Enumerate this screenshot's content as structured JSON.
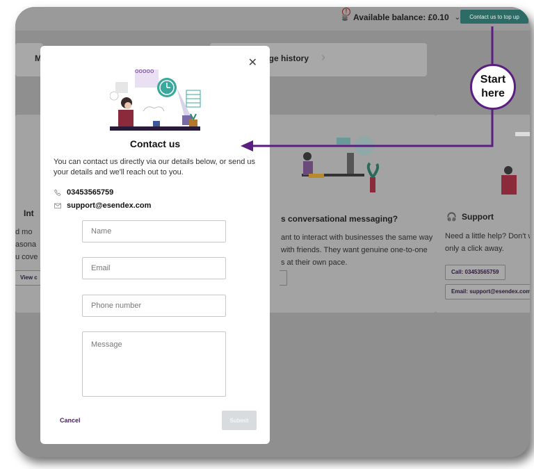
{
  "topbar": {
    "balance_label": "Available balance: £0.10",
    "topup_label": "Contact us to top up"
  },
  "nav": {
    "left_letter": "M",
    "right_label": "age history"
  },
  "bg_cards": {
    "left": {
      "title": "Int",
      "lines": [
        "d mo",
        "asona",
        "u cove"
      ],
      "button": "View c"
    },
    "middle": {
      "title": "s conversational messaging?",
      "lines": [
        "ant to interact with businesses the same way",
        "with friends. They want genuine one-to-one",
        "s at their own pace."
      ]
    },
    "right": {
      "title": "Support",
      "lines": [
        "Need a little help? Don't wo",
        "only a click away."
      ],
      "call_button": "Call: 03453565759",
      "email_button": "Email: support@esendex.com"
    }
  },
  "modal": {
    "title": "Contact us",
    "description": "You can contact us directly via our details below, or send us your details and we'll reach out to you.",
    "phone": "03453565759",
    "email": "support@esendex.com",
    "fields": {
      "name_placeholder": "Name",
      "email_placeholder": "Email",
      "phone_placeholder": "Phone number",
      "message_placeholder": "Message"
    },
    "cancel_label": "Cancel",
    "submit_label": "Submit"
  },
  "annotation": {
    "line1": "Start",
    "line2": "here"
  },
  "colors": {
    "accent_purple": "#5a1d82",
    "topup_button": "#2c6b66",
    "overlay_gray": "#8f8f8f"
  }
}
